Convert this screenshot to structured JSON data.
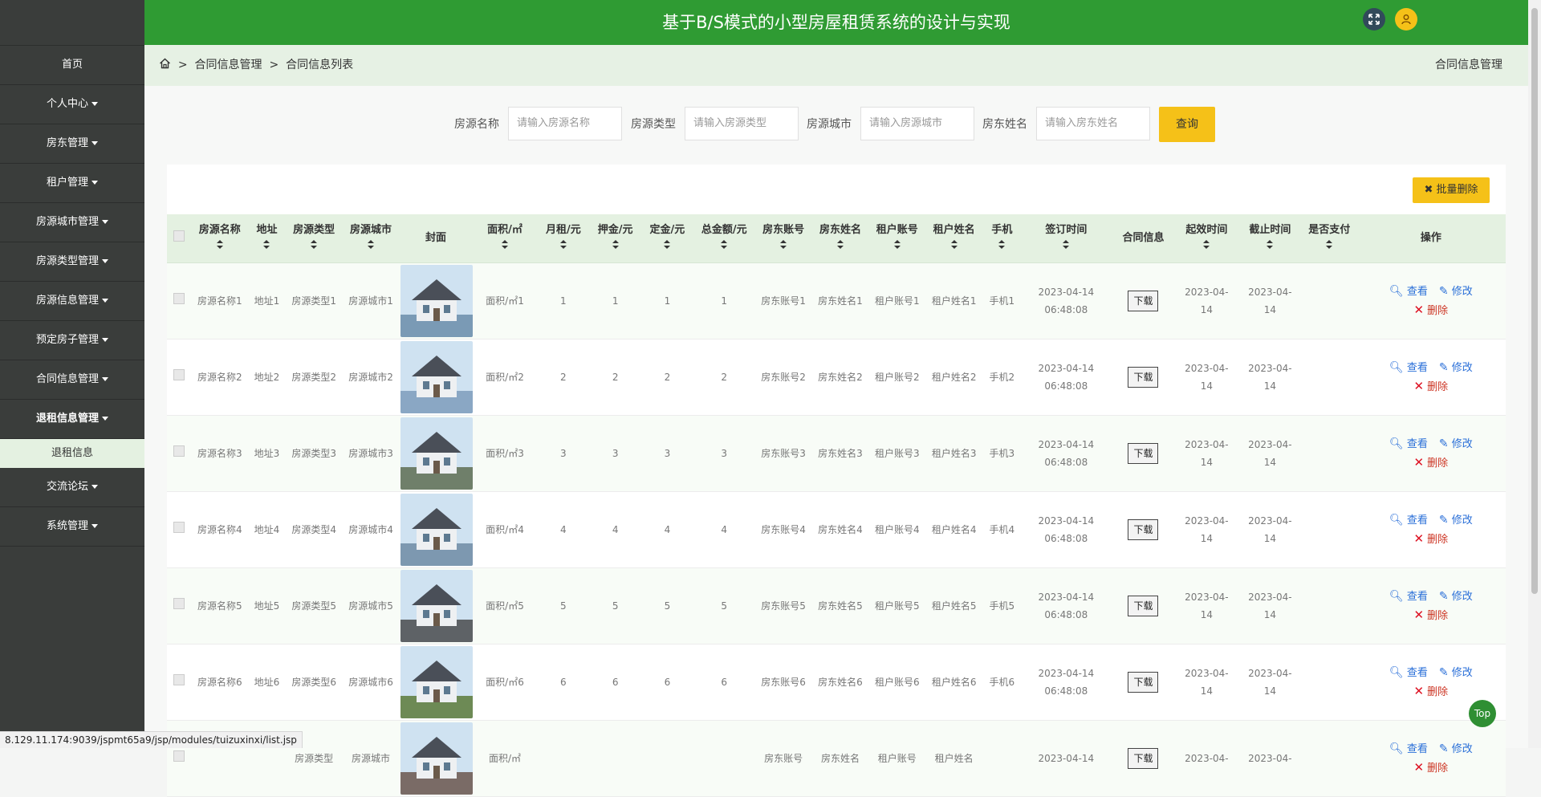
{
  "header": {
    "title": "基于B/S模式的小型房屋租赁系统的设计与实现",
    "icon_expand": "expand-icon",
    "icon_user": "user-icon"
  },
  "sidebar": {
    "items": [
      {
        "label": "首页",
        "caret": false
      },
      {
        "label": "个人中心",
        "caret": true
      },
      {
        "label": "房东管理",
        "caret": true
      },
      {
        "label": "租户管理",
        "caret": true
      },
      {
        "label": "房源城市管理",
        "caret": true
      },
      {
        "label": "房源类型管理",
        "caret": true
      },
      {
        "label": "房源信息管理",
        "caret": true
      },
      {
        "label": "预定房子管理",
        "caret": true
      },
      {
        "label": "合同信息管理",
        "caret": true
      },
      {
        "label": "退租信息管理",
        "caret": true
      },
      {
        "label": "交流论坛",
        "caret": true
      },
      {
        "label": "系统管理",
        "caret": true
      }
    ],
    "submenu_label": "退租信息"
  },
  "breadcrumb": {
    "level1": "合同信息管理",
    "level2": "合同信息列表",
    "right": "合同信息管理"
  },
  "search": {
    "fields": [
      {
        "label": "房源名称",
        "placeholder": "请输入房源名称"
      },
      {
        "label": "房源类型",
        "placeholder": "请输入房源类型"
      },
      {
        "label": "房源城市",
        "placeholder": "请输入房源城市"
      },
      {
        "label": "房东姓名",
        "placeholder": "请输入房东姓名"
      }
    ],
    "button": "查询"
  },
  "batch_delete": "批量删除",
  "table": {
    "headers": [
      "房源名称",
      "地址",
      "房源类型",
      "房源城市",
      "封面",
      "面积/㎡",
      "月租/元",
      "押金/元",
      "定金/元",
      "总金额/元",
      "房东账号",
      "房东姓名",
      "租户账号",
      "租户姓名",
      "手机",
      "签订时间",
      "合同信息",
      "起效时间",
      "截止时间",
      "是否支付",
      "操作"
    ],
    "rows": [
      {
        "name": "房源名称1",
        "addr": "地址1",
        "type": "房源类型1",
        "city": "房源城市1",
        "area": "面积/㎡1",
        "rent": "1",
        "deposit": "1",
        "earnest": "1",
        "total": "1",
        "lacc": "房东账号1",
        "lname": "房东姓名1",
        "tacc": "租户账号1",
        "tname": "租户姓名1",
        "phone": "手机1",
        "sign1": "2023-04-14",
        "sign2": "06:48:08",
        "start1": "2023-04-",
        "start2": "14",
        "end1": "2023-04-",
        "end2": "14",
        "paid": "",
        "cover_color": "#7a9ab5"
      },
      {
        "name": "房源名称2",
        "addr": "地址2",
        "type": "房源类型2",
        "city": "房源城市2",
        "area": "面积/㎡2",
        "rent": "2",
        "deposit": "2",
        "earnest": "2",
        "total": "2",
        "lacc": "房东账号2",
        "lname": "房东姓名2",
        "tacc": "租户账号2",
        "tname": "租户姓名2",
        "phone": "手机2",
        "sign1": "2023-04-14",
        "sign2": "06:48:08",
        "start1": "2023-04-",
        "start2": "14",
        "end1": "2023-04-",
        "end2": "14",
        "paid": "",
        "cover_color": "#8aa7c4"
      },
      {
        "name": "房源名称3",
        "addr": "地址3",
        "type": "房源类型3",
        "city": "房源城市3",
        "area": "面积/㎡3",
        "rent": "3",
        "deposit": "3",
        "earnest": "3",
        "total": "3",
        "lacc": "房东账号3",
        "lname": "房东姓名3",
        "tacc": "租户账号3",
        "tname": "租户姓名3",
        "phone": "手机3",
        "sign1": "2023-04-14",
        "sign2": "06:48:08",
        "start1": "2023-04-",
        "start2": "14",
        "end1": "2023-04-",
        "end2": "14",
        "paid": "",
        "cover_color": "#6f7f6a"
      },
      {
        "name": "房源名称4",
        "addr": "地址4",
        "type": "房源类型4",
        "city": "房源城市4",
        "area": "面积/㎡4",
        "rent": "4",
        "deposit": "4",
        "earnest": "4",
        "total": "4",
        "lacc": "房东账号4",
        "lname": "房东姓名4",
        "tacc": "租户账号4",
        "tname": "租户姓名4",
        "phone": "手机4",
        "sign1": "2023-04-14",
        "sign2": "06:48:08",
        "start1": "2023-04-",
        "start2": "14",
        "end1": "2023-04-",
        "end2": "14",
        "paid": "",
        "cover_color": "#7d98b0"
      },
      {
        "name": "房源名称5",
        "addr": "地址5",
        "type": "房源类型5",
        "city": "房源城市5",
        "area": "面积/㎡5",
        "rent": "5",
        "deposit": "5",
        "earnest": "5",
        "total": "5",
        "lacc": "房东账号5",
        "lname": "房东姓名5",
        "tacc": "租户账号5",
        "tname": "租户姓名5",
        "phone": "手机5",
        "sign1": "2023-04-14",
        "sign2": "06:48:08",
        "start1": "2023-04-",
        "start2": "14",
        "end1": "2023-04-",
        "end2": "14",
        "paid": "",
        "cover_color": "#5e6266"
      },
      {
        "name": "房源名称6",
        "addr": "地址6",
        "type": "房源类型6",
        "city": "房源城市6",
        "area": "面积/㎡6",
        "rent": "6",
        "deposit": "6",
        "earnest": "6",
        "total": "6",
        "lacc": "房东账号6",
        "lname": "房东姓名6",
        "tacc": "租户账号6",
        "tname": "租户姓名6",
        "phone": "手机6",
        "sign1": "2023-04-14",
        "sign2": "06:48:08",
        "start1": "2023-04-",
        "start2": "14",
        "end1": "2023-04-",
        "end2": "14",
        "paid": "",
        "cover_color": "#6d8a55"
      },
      {
        "name": "",
        "addr": "",
        "type": "房源类型",
        "city": "房源城市",
        "area": "面积/㎡",
        "rent": "",
        "deposit": "",
        "earnest": "",
        "total": "",
        "lacc": "房东账号",
        "lname": "房东姓名",
        "tacc": "租户账号",
        "tname": "租户姓名",
        "phone": "",
        "sign1": "2023-04-14",
        "sign2": "",
        "start1": "2023-04-",
        "start2": "",
        "end1": "2023-04-",
        "end2": "",
        "paid": "",
        "cover_color": "#7a6b66"
      }
    ],
    "download_label": "下载",
    "view_label": "查看",
    "edit_label": "修改",
    "delete_label": "删除"
  },
  "top_button": "Top",
  "status_url": "8.129.11.174:9039/jspmt65a9/jsp/modules/tuizuxinxi/list.jsp",
  "colors": {
    "header_green": "#2f9b33",
    "sidebar": "#3a3d3b",
    "accent_yellow": "#f5c118"
  }
}
